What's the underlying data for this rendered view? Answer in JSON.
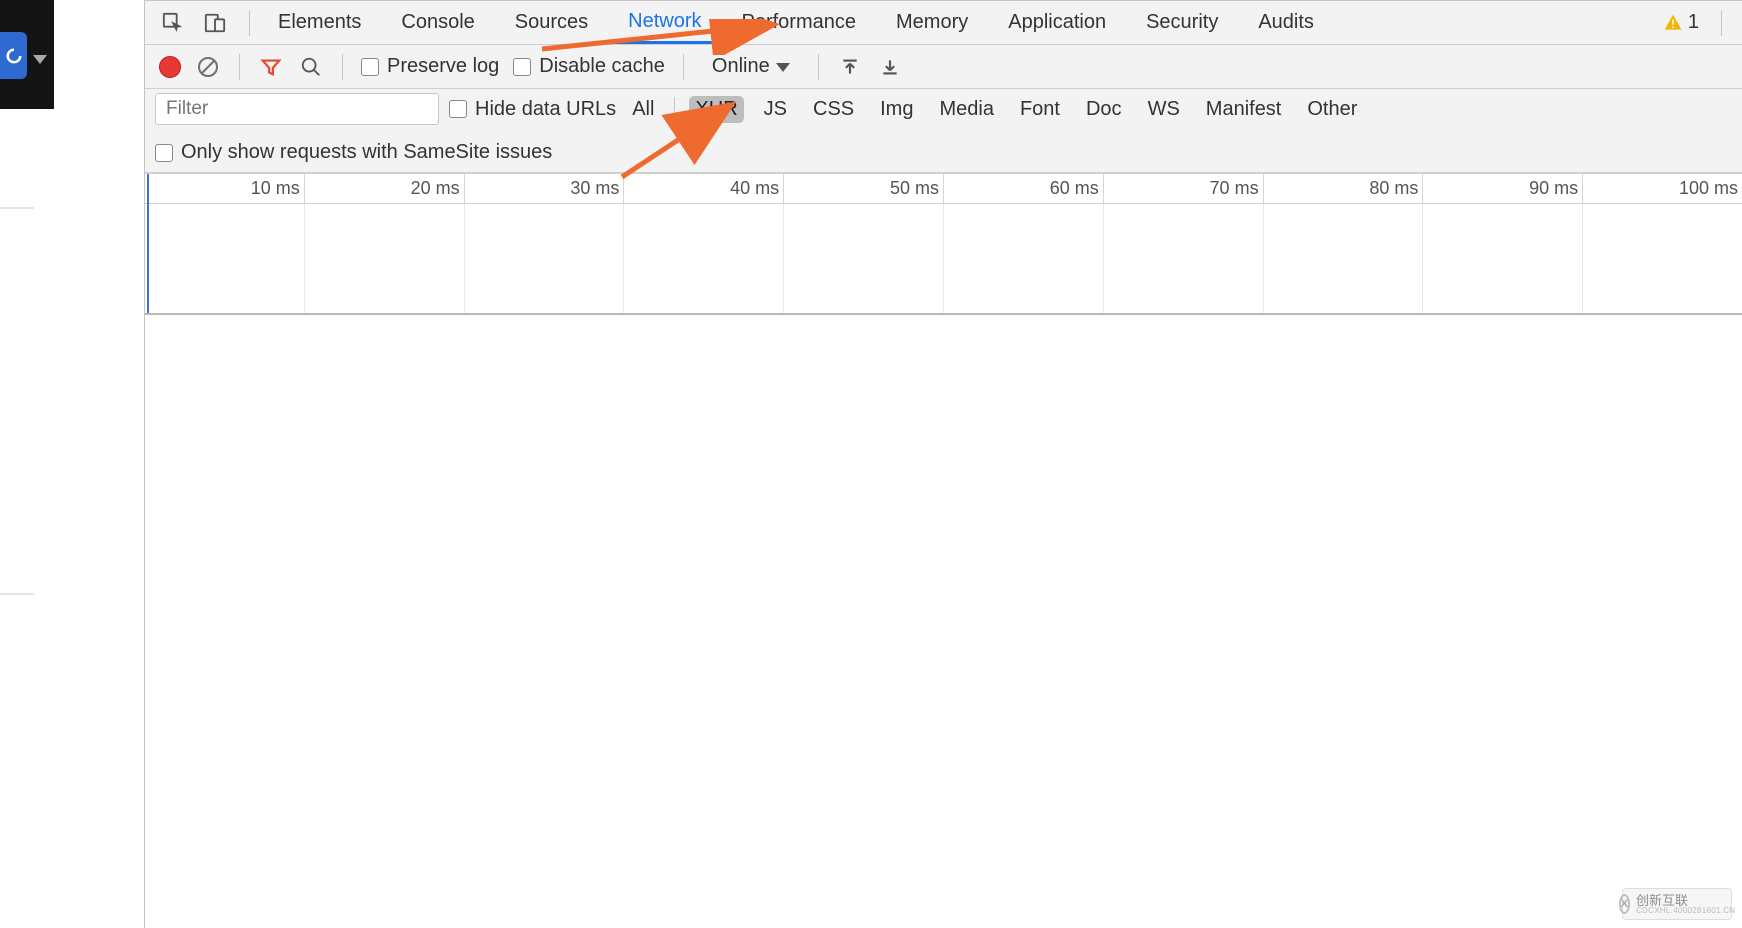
{
  "tabs": {
    "elements": "Elements",
    "console": "Console",
    "sources": "Sources",
    "network": "Network",
    "performance": "Performance",
    "memory": "Memory",
    "application": "Application",
    "security": "Security",
    "audits": "Audits",
    "active": "network"
  },
  "issues": {
    "count": "1"
  },
  "toolbar": {
    "preserve_log": "Preserve log",
    "disable_cache": "Disable cache",
    "throttling_selected": "Online"
  },
  "filter": {
    "placeholder": "Filter",
    "hide_data_urls": "Hide data URLs",
    "types": {
      "all": "All",
      "xhr": "XHR",
      "js": "JS",
      "css": "CSS",
      "img": "Img",
      "media": "Media",
      "font": "Font",
      "doc": "Doc",
      "ws": "WS",
      "manifest": "Manifest",
      "other": "Other"
    },
    "selected_type": "xhr",
    "samesite": "Only show requests with SameSite issues"
  },
  "timeline": {
    "ticks": [
      "10 ms",
      "20 ms",
      "30 ms",
      "40 ms",
      "50 ms",
      "60 ms",
      "70 ms",
      "80 ms",
      "90 ms",
      "100 ms"
    ]
  },
  "watermark": {
    "cn": "创新互联",
    "en": "CDCXHL.4000281601.CN"
  }
}
